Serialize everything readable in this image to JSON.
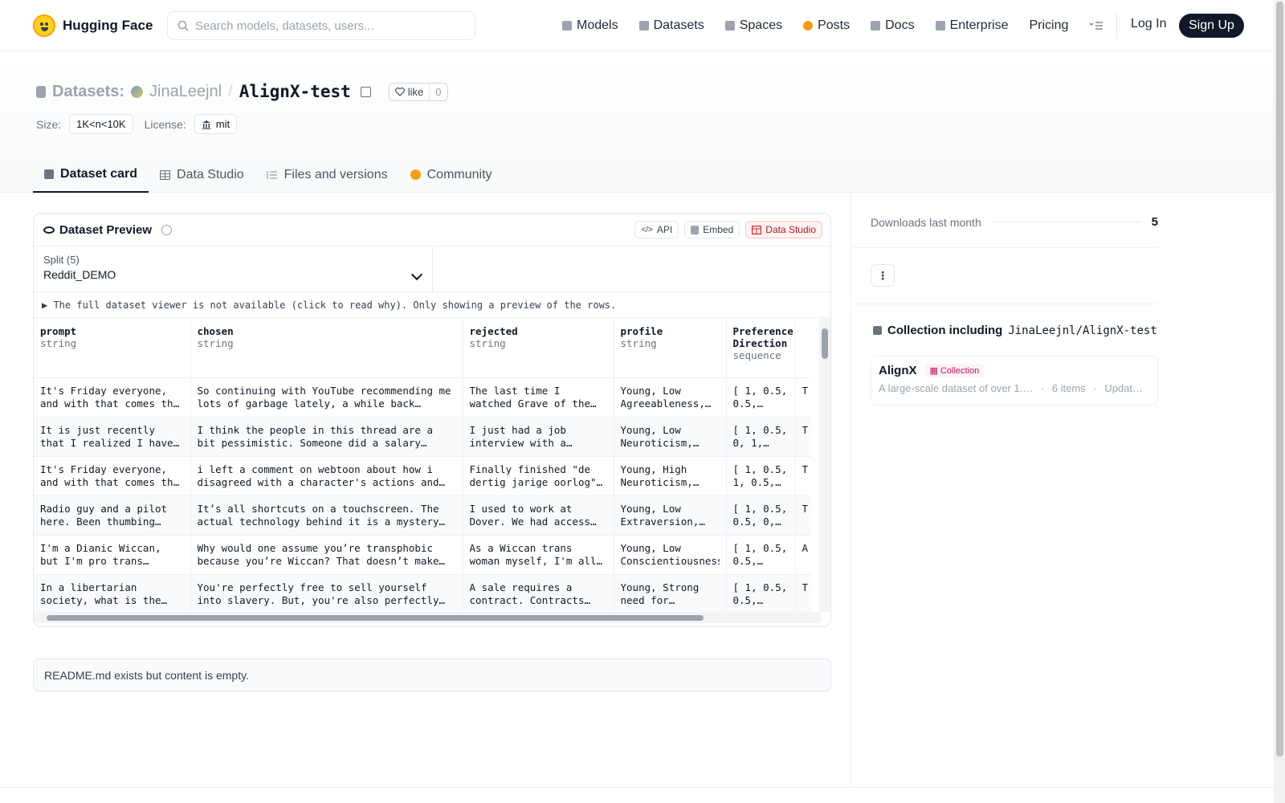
{
  "nav": {
    "brand": "Hugging Face",
    "search_placeholder": "Search models, datasets, users...",
    "links": [
      {
        "label": "Models",
        "icon": "cube-icon",
        "color": "#9ca3af"
      },
      {
        "label": "Datasets",
        "icon": "database-icon",
        "color": "#9ca3af"
      },
      {
        "label": "Spaces",
        "icon": "grid-icon",
        "color": "#9ca3af"
      },
      {
        "label": "Posts",
        "icon": "chat-icon",
        "color": "#f59e0b"
      },
      {
        "label": "Docs",
        "icon": "book-icon",
        "color": "#9ca3af"
      },
      {
        "label": "Enterprise",
        "icon": "enterprise-icon",
        "color": "#9ca3af"
      },
      {
        "label": "Pricing",
        "icon": "",
        "color": ""
      }
    ],
    "login": "Log In",
    "signup": "Sign Up"
  },
  "repo": {
    "prefix": "Datasets:",
    "user": "JinaLeejnl",
    "slash": "/",
    "name": "AlignX-test",
    "like_label": "like",
    "like_count": "0",
    "size_label": "Size:",
    "size_value": "1K<n<10K",
    "license_label": "License:",
    "license_value": "mit"
  },
  "tabs": [
    {
      "label": "Dataset card",
      "active": true
    },
    {
      "label": "Data Studio",
      "active": false
    },
    {
      "label": "Files and versions",
      "active": false
    },
    {
      "label": "Community",
      "active": false
    }
  ],
  "preview": {
    "title": "Dataset Preview",
    "btn_api": "API",
    "btn_embed": "Embed",
    "btn_studio": "Data Studio",
    "split_label": "Split (5)",
    "split_value": "Reddit_DEMO",
    "notice": "▶ The full dataset viewer is not available (click to read why). Only showing a preview of the rows.",
    "columns": [
      {
        "name": "prompt",
        "type": "string",
        "width": 195
      },
      {
        "name": "chosen",
        "type": "string",
        "width": 339
      },
      {
        "name": "rejected",
        "type": "string",
        "width": 188
      },
      {
        "name": "profile",
        "type": "string",
        "width": 140
      },
      {
        "name": "Preference Direction",
        "type": "sequence",
        "width": 86
      },
      {
        "name": "",
        "type": "",
        "width": 40
      }
    ],
    "rows": [
      [
        "It's Friday everyone, and with that comes the newest…",
        "So continuing with YouTube recommending me lots of garbage lately, a while back autoplay…",
        "The last time I watched Grave of the Fireflies, …",
        "Young, Low Agreeableness,…",
        "[ 1, 0.5, 0.5, 0.5,…",
        "T b"
      ],
      [
        "It is just recently that I realized I have no idea…",
        "I think the people in this thread are a bit pessimistic. Someone did a salary thread a few…",
        "I just had a job interview with a private…",
        "Young, Low Neuroticism, High…",
        "[ 1, 0.5, 0, 1, 0.5…",
        "T s"
      ],
      [
        "It's Friday everyone, and with that comes the newest…",
        "i left a comment on webtoon about how i disagreed with a character's actions and some…",
        "Finally finished \"de dertig jarige oorlog\" by…",
        "Young, High Neuroticism, Low…",
        "[ 1, 0.5, 1, 0.5, 0…",
        "T s"
      ],
      [
        "Radio guy and a pilot here. Been thumbing…",
        "It’s all shortcuts on a touchscreen. The actual technology behind it is a mystery to most…",
        "I used to work at Dover. We had access to ZDC and…",
        "Young, Low Extraversion,…",
        "[ 1, 0.5, 0.5, 0,…",
        "T s"
      ],
      [
        "I'm a Dianic Wiccan, but I'm pro trans rights and …",
        "Why would one assume you’re transphobic because you’re Wiccan? That doesn’t make any sense. I’…",
        "As a Wiccan trans woman myself, I'm all for the…",
        "Young, Low Conscientiousness…",
        "[ 1, 0.5, 0.5, 0.5,…",
        "A h"
      ],
      [
        "In a libertarian society, what is the furthest…",
        "You're perfectly free to sell yourself into slavery. But, you're also perfectly free to…",
        "A sale requires a contract. Contracts are…",
        "Young, Strong need for Contrariance…",
        "[ 1, 0.5, 0.5, 0.5,…",
        "T b"
      ]
    ]
  },
  "readme": "README.md exists but content is empty.",
  "sidebar": {
    "downloads_label": "Downloads last month",
    "downloads_value": "5",
    "more": "⋮",
    "collection_heading": "Collection including",
    "collection_repo": "JinaLeejnl/AlignX-test",
    "collection_name": "AlignX",
    "collection_badge": "Collection",
    "collection_desc": "A large-scale dataset of over 1.…",
    "collection_items": "6 items",
    "collection_updated": "Updat…"
  }
}
